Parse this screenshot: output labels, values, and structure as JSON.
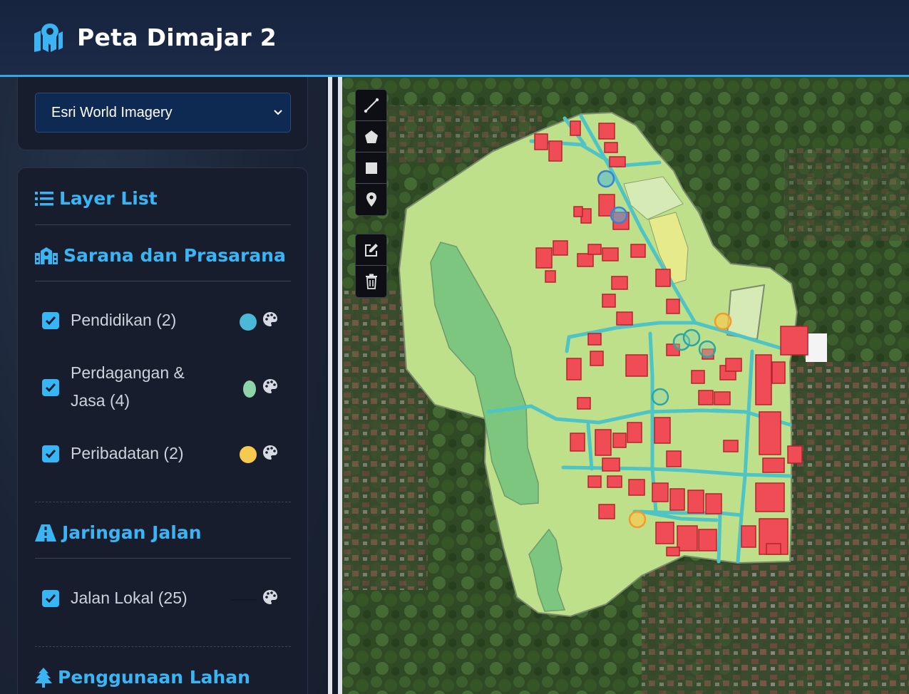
{
  "header": {
    "title": "Peta Dimajar 2",
    "logo_icon": "map-marked-icon"
  },
  "basemap": {
    "selected": "Esri World Imagery",
    "icon": "chevron-down-icon"
  },
  "layer_list": {
    "title": "Layer List",
    "sections": [
      {
        "title": "Sarana dan Prasarana",
        "icon": "school-icon",
        "items": [
          {
            "label": "Pendidikan (2)",
            "checked": true,
            "color": "#4bb8d8"
          },
          {
            "label_line1": "Perdagangan &",
            "label_line2": "Jasa (4)",
            "checked": true,
            "color": "#8fd4a8"
          },
          {
            "label": "Peribadatan (2)",
            "checked": true,
            "color": "#f6c94f"
          }
        ]
      },
      {
        "title": "Jaringan Jalan",
        "icon": "road-icon",
        "items": [
          {
            "label": "Jalan Lokal (25)",
            "checked": true,
            "color": "#1a1e2a"
          }
        ]
      },
      {
        "title": "Penggunaan Lahan",
        "icon": "tree-icon"
      }
    ]
  },
  "map": {
    "colors": {
      "land": "#bfe08a",
      "green_area": "#7cc67f",
      "building": "#ef4c56",
      "road": "#4fc4c4",
      "field": "#d6eab5"
    },
    "draw_tools": [
      "draw-polyline-icon",
      "draw-polygon-icon",
      "draw-rectangle-icon",
      "draw-marker-icon"
    ],
    "edit_tools": [
      "edit-layers-icon",
      "delete-layers-icon"
    ]
  }
}
